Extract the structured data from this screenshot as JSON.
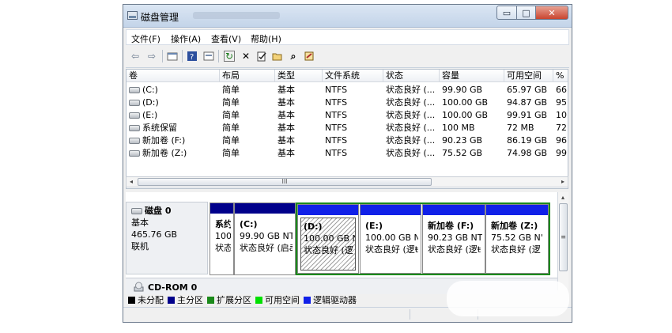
{
  "window": {
    "title": "磁盘管理",
    "min_glyph": "▭",
    "max_glyph": "□",
    "close_glyph": "✕"
  },
  "menu": [
    "文件(F)",
    "操作(A)",
    "查看(V)",
    "帮助(H)"
  ],
  "toolbar": {
    "icons": [
      "back-icon",
      "forward-icon",
      "properties-icon",
      "help-icon",
      "view-icon",
      "refresh-icon",
      "delete-icon",
      "check-icon",
      "open-icon",
      "search-icon",
      "wizard-icon"
    ],
    "glyphs": {
      "back": "⇦",
      "forward": "⇨",
      "refresh": "↻",
      "delete": "✕",
      "search": "⌕"
    }
  },
  "volumes": {
    "headers": [
      "卷",
      "布局",
      "类型",
      "文件系统",
      "状态",
      "容量",
      "可用空间",
      "%"
    ],
    "rows": [
      [
        "(C:)",
        "简单",
        "基本",
        "NTFS",
        "状态良好 (...",
        "99.90 GB",
        "65.97 GB",
        "66"
      ],
      [
        "(D:)",
        "简单",
        "基本",
        "NTFS",
        "状态良好 (...",
        "100.00 GB",
        "94.87 GB",
        "95"
      ],
      [
        "(E:)",
        "简单",
        "基本",
        "NTFS",
        "状态良好 (...",
        "100.00 GB",
        "99.91 GB",
        "10("
      ],
      [
        "系统保留",
        "简单",
        "基本",
        "NTFS",
        "状态良好 (...",
        "100 MB",
        "72 MB",
        "72"
      ],
      [
        "新加卷 (F:)",
        "简单",
        "基本",
        "NTFS",
        "状态良好 (...",
        "90.23 GB",
        "86.19 GB",
        "96"
      ],
      [
        "新加卷 (Z:)",
        "简单",
        "基本",
        "NTFS",
        "状态良好 (...",
        "75.52 GB",
        "74.98 GB",
        "99"
      ]
    ],
    "hscroll_thumb_text": "III",
    "left_arrow": "◂",
    "right_arrow": "▸"
  },
  "disk0": {
    "name": "磁盘 0",
    "type": "基本",
    "size": "465.76 GB",
    "status": "联机",
    "partitions": [
      {
        "label": "系约",
        "size": "100",
        "status": "状态"
      },
      {
        "label": "(C:)",
        "size": "99.90 GB NT",
        "status": "状态良好 (启ā"
      },
      {
        "label": "(D:)",
        "size": "100.00 GB N",
        "status": "状态良好 (逻"
      },
      {
        "label": "(E:)",
        "size": "100.00 GB N",
        "status": "状态良好 (逻ŧ"
      },
      {
        "label": "新加卷  (F:)",
        "size": "90.23 GB NT",
        "status": "状态良好 (逻ŧ"
      },
      {
        "label": "新加卷  (Z:)",
        "size": "75.52 GB N'",
        "status": "状态良好 (逻"
      }
    ]
  },
  "vscroll": {
    "up": "▴",
    "thumb": "≡"
  },
  "cdrom": {
    "name": "CD-ROM 0"
  },
  "legend": [
    {
      "label": "未分配",
      "color": "#000000"
    },
    {
      "label": "主分区",
      "color": "#00008b"
    },
    {
      "label": "扩展分区",
      "color": "#1b8a1b"
    },
    {
      "label": "可用空间",
      "color": "#00e000"
    },
    {
      "label": "逻辑驱动器",
      "color": "#1020e8"
    }
  ],
  "colors": {
    "primary_bar": "#00008b",
    "logical_bar": "#1020e8",
    "extended_border": "#1b8a1b"
  }
}
